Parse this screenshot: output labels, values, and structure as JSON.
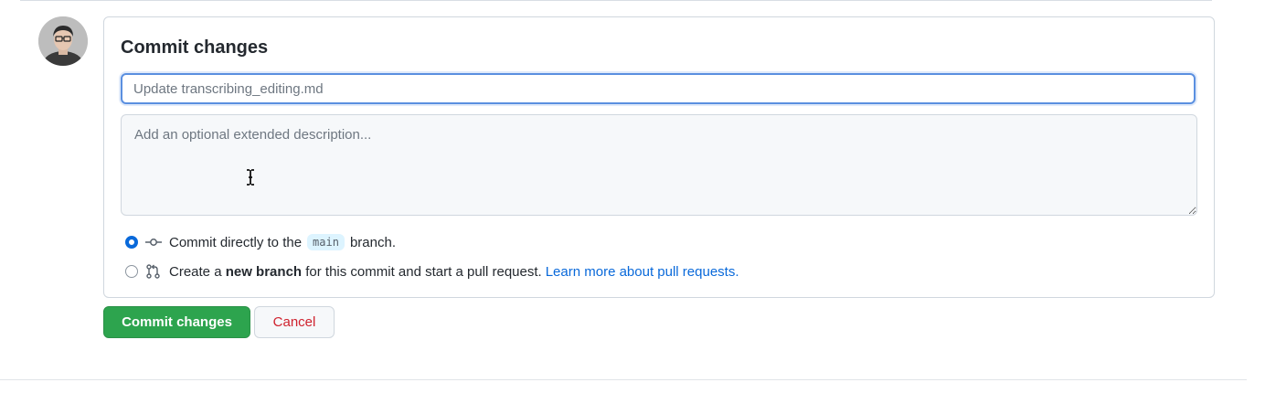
{
  "commit_form": {
    "title": "Commit changes",
    "summary_placeholder": "Update transcribing_editing.md",
    "summary_value": "",
    "description_placeholder": "Add an optional extended description...",
    "description_value": "",
    "options": {
      "direct": {
        "prefix": "Commit directly to the",
        "branch": "main",
        "suffix": "branch.",
        "selected": true
      },
      "new_branch": {
        "prefix": "Create a",
        "bold": "new branch",
        "middle": "for this commit and start a pull request.",
        "link": "Learn more about pull requests.",
        "selected": false
      }
    },
    "buttons": {
      "commit": "Commit changes",
      "cancel": "Cancel"
    }
  },
  "colors": {
    "primary_green": "#2da44e",
    "link_blue": "#0969da",
    "cancel_red": "#cf222e",
    "focus_blue": "#5a8fe0"
  },
  "icons": {
    "avatar": "user-avatar",
    "direct_commit": "git-commit-icon",
    "pull_request": "git-pull-request-icon",
    "text_cursor": "i-beam-cursor-icon"
  }
}
